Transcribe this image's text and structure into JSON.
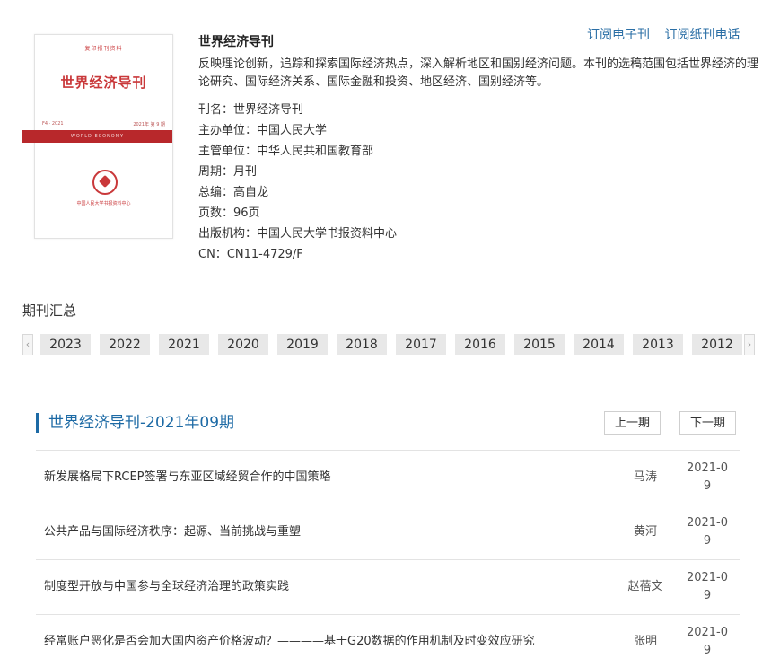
{
  "journal": {
    "title": "世界经济导刊",
    "description": "反映理论创新，追踪和探索国际经济热点，深入解析地区和国别经济问题。本刊的选稿范围包括世界经济的理论研究、国际经济关系、国际金融和投资、地区经济、国别经济等。",
    "meta": [
      {
        "label": "刊名：",
        "value": "世界经济导刊"
      },
      {
        "label": "主办单位：",
        "value": "中国人民大学"
      },
      {
        "label": "主管单位：",
        "value": "中华人民共和国教育部"
      },
      {
        "label": "周期：",
        "value": "月刊"
      },
      {
        "label": "总编：",
        "value": "高自龙"
      },
      {
        "label": "页数：",
        "value": "96页"
      },
      {
        "label": "出版机构：",
        "value": "中国人民大学书报资料中心"
      },
      {
        "label": "CN：",
        "value": "CN11-4729/F"
      }
    ]
  },
  "cover": {
    "top_text": "复印报刊资料",
    "title": "世界经济导刊",
    "small_left": "F4 · 2021",
    "small_right": "2021年 第 9 期",
    "band_text": "WORLD ECONOMY",
    "bottom_text": "中国人民大学书报资料中心"
  },
  "subscribe": {
    "electronic": "订阅电子刊",
    "paper_phone": "订阅纸刊电话"
  },
  "archive": {
    "label": "期刊汇总",
    "prev_arrow": "‹",
    "next_arrow": "›",
    "years": [
      "2023",
      "2022",
      "2021",
      "2020",
      "2019",
      "2018",
      "2017",
      "2016",
      "2015",
      "2014",
      "2013",
      "2012"
    ]
  },
  "issue": {
    "title": "世界经济导刊-2021年09期",
    "prev_label": "上一期",
    "next_label": "下一期"
  },
  "articles": [
    {
      "title": "新发展格局下RCEP签署与东亚区域经贸合作的中国策略",
      "author": "马涛",
      "date": "2021-09"
    },
    {
      "title": "公共产品与国际经济秩序：起源、当前挑战与重塑",
      "author": "黄河",
      "date": "2021-09"
    },
    {
      "title": "制度型开放与中国参与全球经济治理的政策实践",
      "author": "赵蓓文",
      "date": "2021-09"
    },
    {
      "title": "经常账户恶化是否会加大国内资产价格波动？————基于G20数据的作用机制及时变效应研究",
      "author": "张明",
      "date": "2021-09"
    }
  ],
  "colors": {
    "accent": "#1d6aa5",
    "link": "#2b6fa6",
    "cover_red": "#c9383a"
  }
}
